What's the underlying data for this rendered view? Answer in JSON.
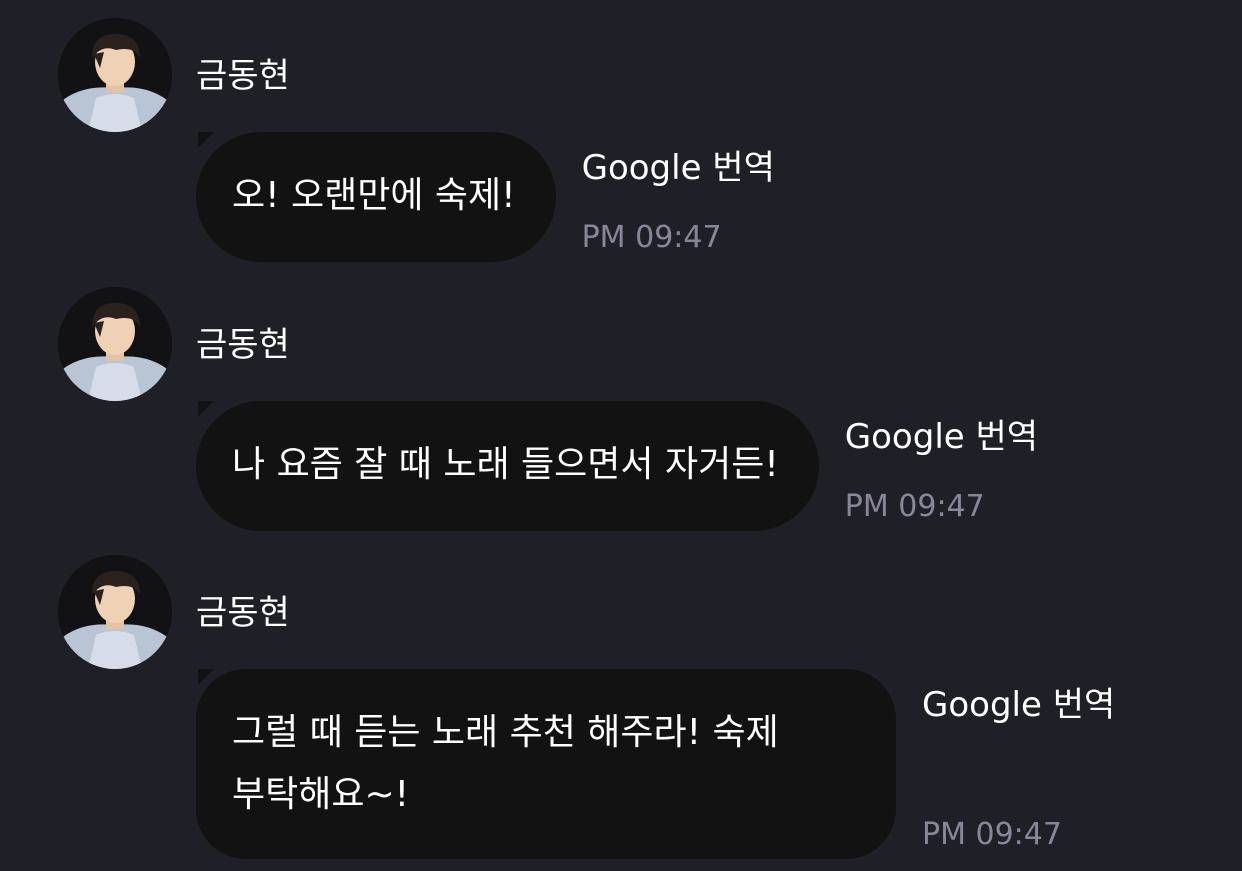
{
  "messages": [
    {
      "sender": "금동현",
      "text": "오! 오랜만에 숙제!",
      "translate_label": "Google 번역",
      "time": "PM 09:47"
    },
    {
      "sender": "금동현",
      "text": "나 요즘 잘 때 노래 들으면서 자거든!",
      "translate_label": "Google 번역",
      "time": "PM 09:47"
    },
    {
      "sender": "금동현",
      "text": "그럴 때 듣는 노래 추천 해주라! 숙제\n부탁해요~!",
      "translate_label": "Google 번역",
      "time": "PM 09:47"
    }
  ],
  "colors": {
    "background": "#1f1f27",
    "bubble": "#121212",
    "text": "#ffffff",
    "timestamp": "#8a8699"
  },
  "icons": {
    "avatar": "profile-photo"
  }
}
